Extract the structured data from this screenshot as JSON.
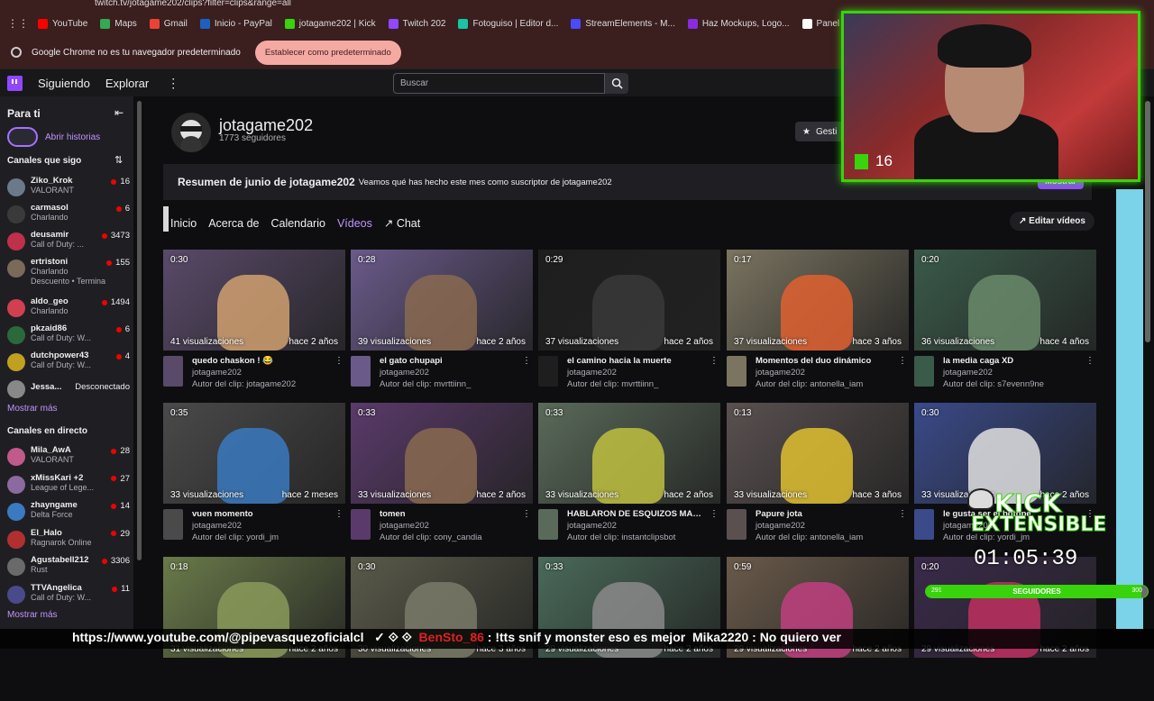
{
  "browser": {
    "url": "twitch.tv/jotagame202/clips?filter=clips&range=all",
    "bookmarks": [
      {
        "label": "YouTube",
        "color": "#ff0000"
      },
      {
        "label": "Maps",
        "color": "#34a853"
      },
      {
        "label": "Gmail",
        "color": "#ea4335"
      },
      {
        "label": "Inicio - PayPal",
        "color": "#1f5fbf"
      },
      {
        "label": "jotagame202 | Kick",
        "color": "#38d30c"
      },
      {
        "label": "Twitch 202",
        "color": "#9147ff"
      },
      {
        "label": "Fotoguiso | Editor d...",
        "color": "#19c3a6"
      },
      {
        "label": "StreamElements - M...",
        "color": "#4a4aff"
      },
      {
        "label": "Haz Mockups, Logo...",
        "color": "#8a2be2"
      },
      {
        "label": "Panel de transmisió...",
        "color": "#ffffff"
      },
      {
        "label": "Ban Twitch Bots",
        "color": "#999999"
      }
    ],
    "infobar_text": "Google Chrome no es tu navegador predeterminado",
    "infobar_button": "Establecer como predeterminado"
  },
  "topnav": {
    "siguiendo": "Siguiendo",
    "explorar": "Explorar",
    "search_placeholder": "Buscar"
  },
  "sidebar": {
    "para_ti": "Para ti",
    "abrir_historias": "Abrir historias",
    "canales_que_sigo": "Canales que sigo",
    "followed": [
      {
        "name": "Ziko_Krok",
        "game": "VALORANT",
        "viewers": "16",
        "color": "#6a7a8a"
      },
      {
        "name": "carmasol",
        "game": "Charlando",
        "viewers": "6",
        "color": "#3a3a3a"
      },
      {
        "name": "deusamir",
        "game": "Call of Duty: ...",
        "viewers": "3473",
        "color": "#c0304a"
      },
      {
        "name": "ertristoni",
        "game": "Charlando",
        "viewers": "155",
        "color": "#7a6a5a",
        "extra": "Descuento • Termina"
      },
      {
        "name": "aldo_geo",
        "game": "Charlando",
        "viewers": "1494",
        "color": "#d04050"
      },
      {
        "name": "pkzaid86",
        "game": "Call of Duty: W...",
        "viewers": "6",
        "color": "#2a6a3a"
      },
      {
        "name": "dutchpower43",
        "game": "Call of Duty: W...",
        "viewers": "4",
        "color": "#c0a020"
      },
      {
        "name": "Jessa...",
        "game": "",
        "viewers": "Desconectado",
        "color": "#888888"
      }
    ],
    "mostrar_mas_1": "Mostrar más",
    "canales_en_directo": "Canales en directo",
    "live": [
      {
        "name": "Mila_AwA",
        "game": "VALORANT",
        "viewers": "28",
        "color": "#c05a8a"
      },
      {
        "name": "xMissKari +2",
        "game": "League of Lege...",
        "viewers": "27",
        "color": "#8a6aa0"
      },
      {
        "name": "zhayngame",
        "game": "Delta Force",
        "viewers": "14",
        "color": "#3a7ac0"
      },
      {
        "name": "El_Halo",
        "game": "Ragnarok Online",
        "viewers": "29",
        "color": "#b03030"
      },
      {
        "name": "Agustabell212",
        "game": "Rust",
        "viewers": "3306",
        "color": "#6a6a6a"
      },
      {
        "name": "TTVAngelica",
        "game": "Call of Duty: W...",
        "viewers": "11",
        "color": "#4a4a8a"
      }
    ],
    "mostrar_mas_2": "Mostrar más"
  },
  "channel": {
    "name": "jotagame202",
    "followers": "1773 seguidores",
    "gestionar": "Gesti",
    "summary_title": "Resumen de junio de jotagame202",
    "summary_desc": "Veamos qué has hecho este mes como suscriptor de jotagame202",
    "mostrar": "Mostrar",
    "tabs": [
      "Inicio",
      "Acerca de",
      "Calendario",
      "Vídeos",
      "Chat"
    ],
    "editar": "Editar vídeos"
  },
  "clips": [
    {
      "dur": "0:30",
      "views": "41 visualizaciones",
      "age": "hace 2 años",
      "title": "quedo chaskon ! 😂",
      "channel": "jotagame202",
      "author": "Autor del clip: jotagame202",
      "bg": "#5a4a6a",
      "accent": "#d0a070"
    },
    {
      "dur": "0:28",
      "views": "39 visualizaciones",
      "age": "hace 2 años",
      "title": "el gato chupapi",
      "channel": "jotagame202",
      "author": "Autor del clip: mvrttiinn_",
      "bg": "#6a5a8a",
      "accent": "#8a6a50"
    },
    {
      "dur": "0:29",
      "views": "37 visualizaciones",
      "age": "hace 2 años",
      "title": "el camino hacia la muerte",
      "channel": "jotagame202",
      "author": "Autor del clip: mvrttiinn_",
      "bg": "#1e1e1e",
      "accent": "#3a3a3a"
    },
    {
      "dur": "0:17",
      "views": "37 visualizaciones",
      "age": "hace 3 años",
      "title": "Momentos del duo dinámico",
      "channel": "jotagame202",
      "author": "Autor del clip: antonella_iam",
      "bg": "#7a7460",
      "accent": "#e06030"
    },
    {
      "dur": "0:20",
      "views": "36 visualizaciones",
      "age": "hace 4 años",
      "title": "la media caga XD",
      "channel": "jotagame202",
      "author": "Autor del clip: s7evenn9ne",
      "bg": "#3a5a4a",
      "accent": "#6a8a6a"
    },
    {
      "dur": "0:35",
      "views": "33 visualizaciones",
      "age": "hace 2 meses",
      "title": "vuen momento",
      "channel": "jotagame202",
      "author": "Autor del clip: yordi_jm",
      "bg": "#4a4a4a",
      "accent": "#3a7ac0"
    },
    {
      "dur": "0:33",
      "views": "33 visualizaciones",
      "age": "hace 2 años",
      "title": "tomen",
      "channel": "jotagame202",
      "author": "Autor del clip: cony_candia",
      "bg": "#5a3a6a",
      "accent": "#8a6a50"
    },
    {
      "dur": "0:33",
      "views": "33 visualizaciones",
      "age": "hace 2 años",
      "title": "HABLARON DE ESQUIZOS MAXI...",
      "channel": "jotagame202",
      "author": "Autor del clip: instantclipsbot",
      "bg": "#5a6a5a",
      "accent": "#c0c040"
    },
    {
      "dur": "0:13",
      "views": "33 visualizaciones",
      "age": "hace 3 años",
      "title": "Papure jota",
      "channel": "jotagame202",
      "author": "Autor del clip: antonella_iam",
      "bg": "#5a5050",
      "accent": "#e0c030"
    },
    {
      "dur": "0:30",
      "views": "33 visualizaciones",
      "age": "hace 2 años",
      "title": "le gusta ser el botope",
      "channel": "jotagame202",
      "author": "Autor del clip: yordi_jm",
      "bg": "#3a4a8a",
      "accent": "#e0e0e0"
    },
    {
      "dur": "0:18",
      "views": "31 visualizaciones",
      "age": "hace 2 años",
      "title": "",
      "channel": "",
      "author": "",
      "bg": "#6a7a4a",
      "accent": "#8a9a5a"
    },
    {
      "dur": "0:30",
      "views": "30 visualizaciones",
      "age": "hace 3 años",
      "title": "",
      "channel": "",
      "author": "",
      "bg": "#5a5a4a",
      "accent": "#7a7a6a"
    },
    {
      "dur": "0:33",
      "views": "29 visualizaciones",
      "age": "hace 2 años",
      "title": "",
      "channel": "",
      "author": "",
      "bg": "#4a6a5a",
      "accent": "#8a8a8a"
    },
    {
      "dur": "0:59",
      "views": "29 visualizaciones",
      "age": "hace 2 años",
      "title": "",
      "channel": "",
      "author": "",
      "bg": "#6a5a4a",
      "accent": "#c04080"
    },
    {
      "dur": "0:20",
      "views": "29 visualizaciones",
      "age": "hace 2 años",
      "title": "",
      "channel": "",
      "author": "",
      "bg": "#3a2a4a",
      "accent": "#c03060"
    }
  ],
  "overlay": {
    "cam_count": "16",
    "kick_line1": "KICK",
    "kick_line2": "EXTENSIBLE",
    "timer": "01:05:39",
    "goal_label": "SEGUIDORES",
    "goal_current": "291",
    "goal_target": "300",
    "goal_progress": 0.97,
    "ticker_parts": [
      {
        "text": "https://www.youtube.com/@pipevasquezoficialcl",
        "red": false
      },
      {
        "text": "   ✓ ⟐ ⟐  ",
        "red": false
      },
      {
        "text": "BenSto_86",
        "red": true
      },
      {
        "text": " : !tts snif y monster eso es mejor  ",
        "red": false
      },
      {
        "text": "Mika2220",
        "red": false
      },
      {
        "text": " : No quiero ver",
        "red": false
      }
    ]
  }
}
